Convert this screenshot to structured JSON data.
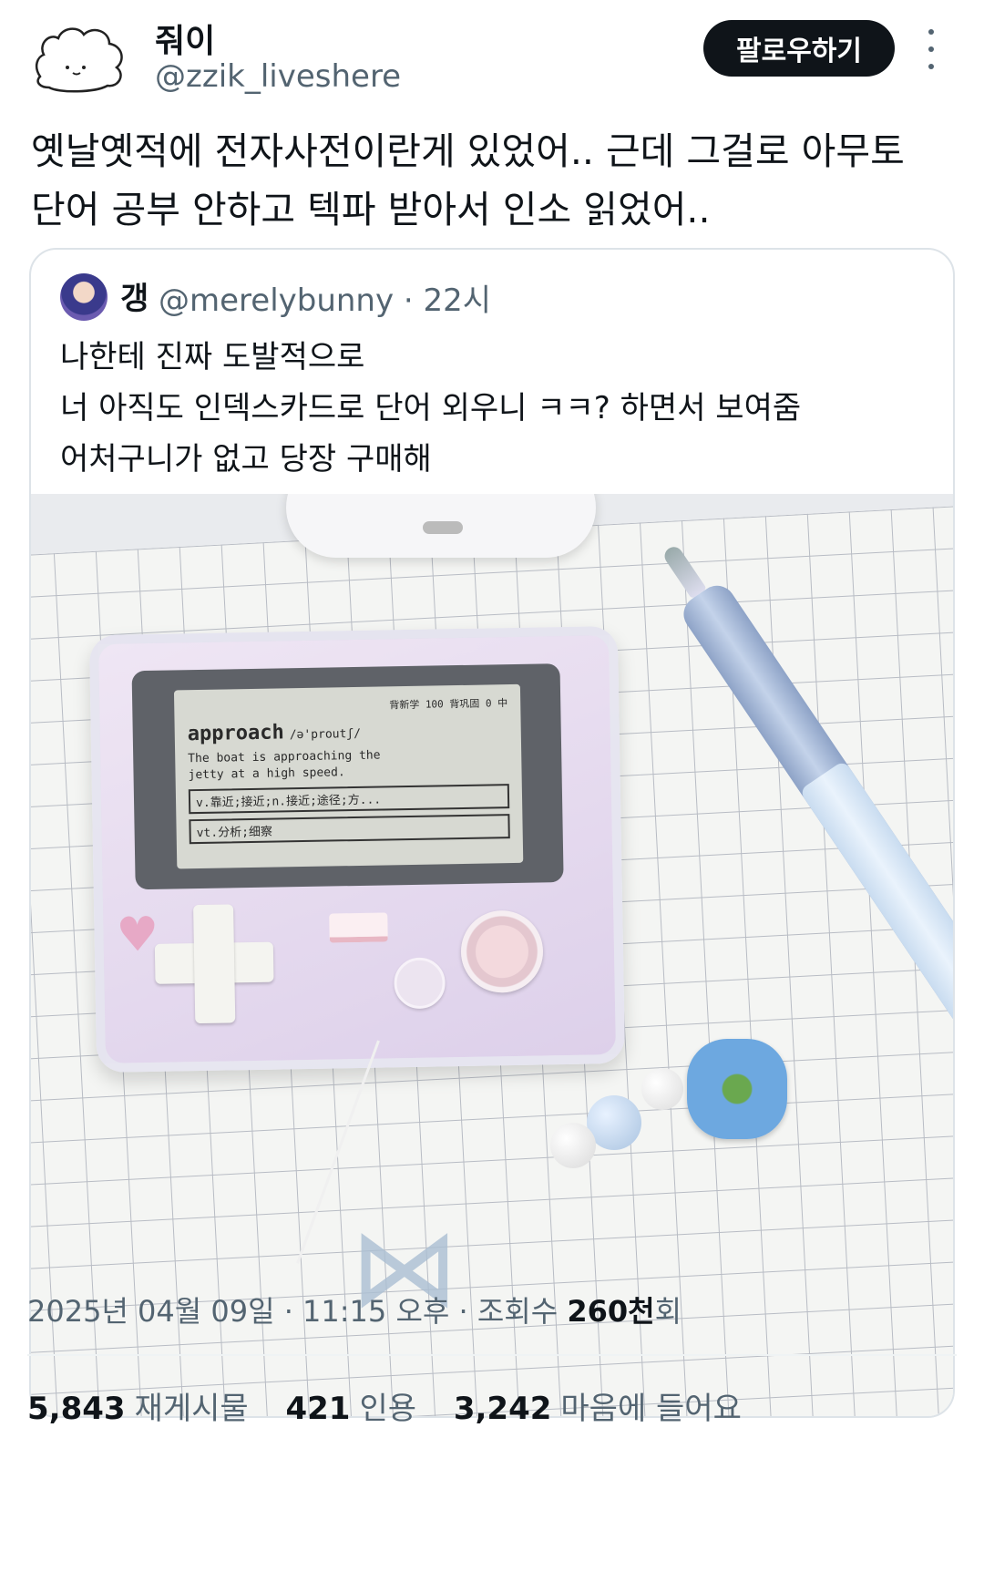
{
  "author": {
    "name": "줘이",
    "handle": "@zzik_liveshere",
    "follow_label": "팔로우하기"
  },
  "tweet": {
    "text": "옛날옛적에 전자사전이란게 있었어.. 근데 그걸로 아무토\n단어 공부 안하고 텍파 받아서 인소 읽었어.."
  },
  "quote": {
    "name": "갱",
    "handle_time": "@merelybunny · 22시",
    "text": "나한테 진짜 도발적으로\n너 아직도 인덱스카드로 단어 외우니 ㅋㅋ? 하면서 보여줌\n어처구니가 없고 당장 구매해",
    "screen": {
      "top": "背新学 100  背巩固  0   中",
      "word": "approach",
      "phonetic": "/ə'proutʃ/",
      "example": "The boat is approaching the\njetty at a high speed.",
      "option1": "v.靠近;接近;n.接近;途径;方...",
      "option2": "vt.分析;细察"
    }
  },
  "meta": {
    "date_time": "2025년 04월 09일 · 11:15 오후 · 조회수 ",
    "views": "260천",
    "views_suffix": "회"
  },
  "stats": {
    "retweets": "5,843",
    "retweets_label": "재게시물",
    "quotes": "421",
    "quotes_label": "인용",
    "likes": "3,242",
    "likes_label": "마음에 들어요"
  }
}
